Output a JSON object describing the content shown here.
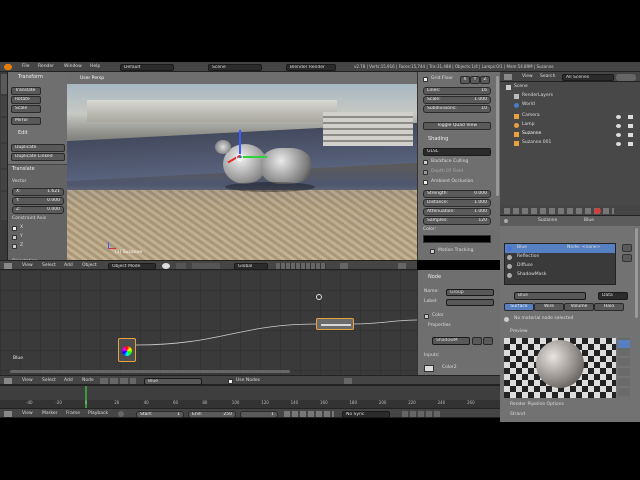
{
  "topbar": {
    "menus": [
      "File",
      "Render",
      "Window",
      "Help"
    ],
    "layout": "Default",
    "scene": "Scene",
    "engine": "Blender Render",
    "stats": "v2.78 | Verts:15,916 | Faces:15,744 | Tris:31,488 | Objects:1/4 | Lamps:0/1 | Mem:54.89M | Suzanne"
  },
  "toolshelf": {
    "tabs": [
      "Tools",
      "Create",
      "Relations",
      "Animation",
      "Physics",
      "Grease Pencil"
    ],
    "transform_header": "Transform",
    "transform_buttons": [
      "Translate",
      "Rotate",
      "Scale",
      "Mirror"
    ],
    "edit_header": "Edit",
    "edit_buttons": [
      "Duplicate",
      "Duplicate Linked"
    ],
    "operator_header": "Translate",
    "vector_label": "Vector",
    "vector": [
      {
        "axis": "X:",
        "value": "1.621"
      },
      {
        "axis": "Y:",
        "value": "0.000"
      },
      {
        "axis": "Z:",
        "value": "0.000"
      }
    ],
    "constraint_label": "Constraint Axis",
    "constraint_axes": [
      "X",
      "Y",
      "Z"
    ],
    "orientation_label": "Orientation"
  },
  "viewport": {
    "label": "User Persp",
    "object_label": "(1) Suzanne",
    "header_menus": [
      "View",
      "Select",
      "Add",
      "Object"
    ],
    "mode": "Object Mode",
    "pivot": "Global"
  },
  "properties_n": {
    "grid_floor": "Grid Floor",
    "grid_axes": [
      "X",
      "Y",
      "Z"
    ],
    "lines": {
      "label": "Lines:",
      "value": "16"
    },
    "scale": {
      "label": "Scale:",
      "value": "1.000"
    },
    "subdivisions": {
      "label": "Subdivisions:",
      "value": "10"
    },
    "toggle_quad": "Toggle Quad View",
    "shading_header": "Shading",
    "shading_mode": "GLSL",
    "backface": "Backface Culling",
    "depth_of_field": "Depth Of Field",
    "ao": "Ambient Occlusion",
    "ao_fields": [
      {
        "label": "Strength:",
        "value": "0.000"
      },
      {
        "label": "Distance:",
        "value": "1.000"
      },
      {
        "label": "Attenuation:",
        "value": "1.000"
      },
      {
        "label": "Samples:",
        "value": "120"
      }
    ],
    "color_label": "Color:",
    "motion_tracking": "Motion Tracking"
  },
  "outliner": {
    "menus": [
      "View",
      "Search"
    ],
    "filter": "All Scenes",
    "items": [
      {
        "name": "Scene",
        "depth": 0
      },
      {
        "name": "RenderLayers",
        "depth": 1
      },
      {
        "name": "World",
        "depth": 1
      },
      {
        "name": "Camera",
        "depth": 1
      },
      {
        "name": "Lamp",
        "depth": 1
      },
      {
        "name": "Suzanne",
        "depth": 1
      },
      {
        "name": "Suzanne.001",
        "depth": 1
      }
    ]
  },
  "material_props": {
    "breadcrumb": [
      "Suzanne",
      "Blue"
    ],
    "slots": [
      "Blue",
      "Reflection",
      "Diffuse",
      "ShadowMask"
    ],
    "slot_node": "Node: <none>",
    "material_name": "Blue",
    "data_dropdown": "Data",
    "tabs": [
      "Surface",
      "Wire",
      "Volume",
      "Halo"
    ],
    "no_node": "No material node selected",
    "preview_header": "Preview",
    "render_pipeline": "Render Pipeline Options",
    "strand": "Strand"
  },
  "node_editor": {
    "frame_label": "Blue",
    "header_menus": [
      "View",
      "Select",
      "Add",
      "Node"
    ],
    "material": "Blue",
    "use_nodes": "Use Nodes",
    "sidebar": {
      "node_header": "Node",
      "name_label": "Name:",
      "name_value": "Group",
      "label_label": "Label:",
      "color_header": "Color",
      "properties_header": "Properties",
      "group_name": "ShadowM",
      "inputs_label": "Inputs:",
      "input_name": "Color2"
    }
  },
  "timeline": {
    "ruler": [
      "-40",
      "-20",
      "0",
      "20",
      "40",
      "60",
      "80",
      "100",
      "120",
      "140",
      "160",
      "180",
      "200",
      "220",
      "240",
      "260"
    ],
    "menus": [
      "View",
      "Marker",
      "Frame",
      "Playback"
    ],
    "start_label": "Start:",
    "start": "1",
    "end_label": "End:",
    "end": "250",
    "current": "1",
    "sync": "No Sync"
  }
}
